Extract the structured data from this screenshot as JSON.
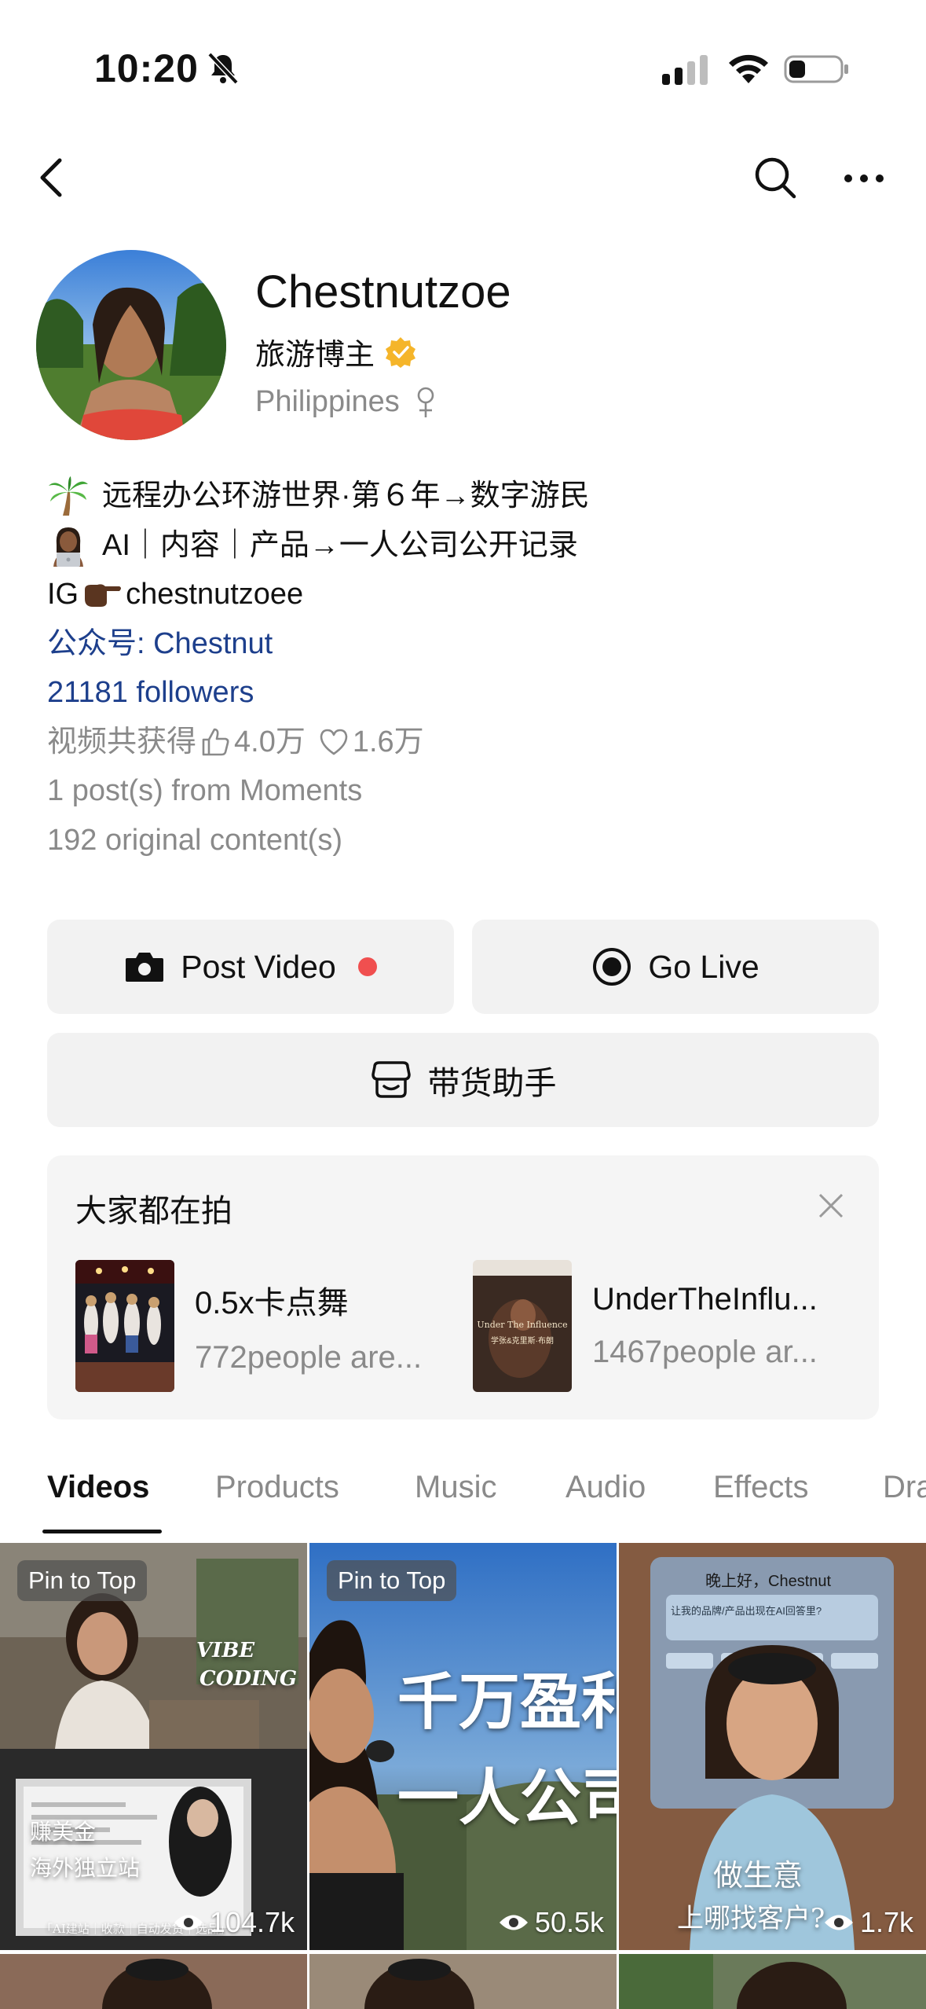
{
  "status_bar": {
    "time": "10:20"
  },
  "profile": {
    "name": "Chestnutzoe",
    "role": "旅游博主",
    "location": "Philippines",
    "bio": [
      {
        "text": "远程办公环游世界·第６年→数字游民",
        "icon": "palm-tree-icon"
      },
      {
        "text": "AI｜内容｜产品→一人公司公开记录",
        "icon": "woman-laptop-icon"
      },
      {
        "prefix": "IG",
        "text": "chestnutzoee",
        "icon": "pointing-hand-icon"
      }
    ],
    "official_account": "公众号: Chestnut",
    "followers": "21181 followers",
    "stats": {
      "label": "视频共获得",
      "likes": "4.0万",
      "hearts": "1.6万"
    },
    "moments": "1 post(s) from Moments",
    "original": "192 original content(s)"
  },
  "actions": {
    "post_video": "Post Video",
    "go_live": "Go Live",
    "assistant": "带货助手"
  },
  "trending": {
    "title": "大家都在拍",
    "items": [
      {
        "name": "0.5x卡点舞",
        "count": "772people are..."
      },
      {
        "name": "UnderTheInflu...",
        "count": "1467people ar...",
        "thumb_caption": "Under The Influence",
        "thumb_sub": "学张&克里斯·布朗"
      }
    ]
  },
  "tabs": [
    "Videos",
    "Products",
    "Music",
    "Audio",
    "Effects",
    "Dra"
  ],
  "videos": [
    {
      "pin": "Pin to Top",
      "views": "104.7k",
      "text_top": "VIBE",
      "text_top2": "CODING",
      "text_a": "赚美金",
      "text_b": "海外独立站",
      "text_c": "「AI建站｜收款｜自动发货｜选品」"
    },
    {
      "pin": "Pin to Top",
      "views": "50.5k",
      "text_a": "千万盈利",
      "text_b": "一人公司"
    },
    {
      "views": "1.7k",
      "greeting": "晚上好，Chestnut",
      "question": "让我的品牌/产品出现在AI回答里?",
      "text_a": "做生意",
      "text_b": "上哪找客户?"
    }
  ],
  "colors": {
    "link": "#1d3f8c",
    "muted": "#8a8a8a",
    "button_bg": "#f2f2f2",
    "accent_red": "#f04f4f",
    "verified": "#f5b52a"
  }
}
